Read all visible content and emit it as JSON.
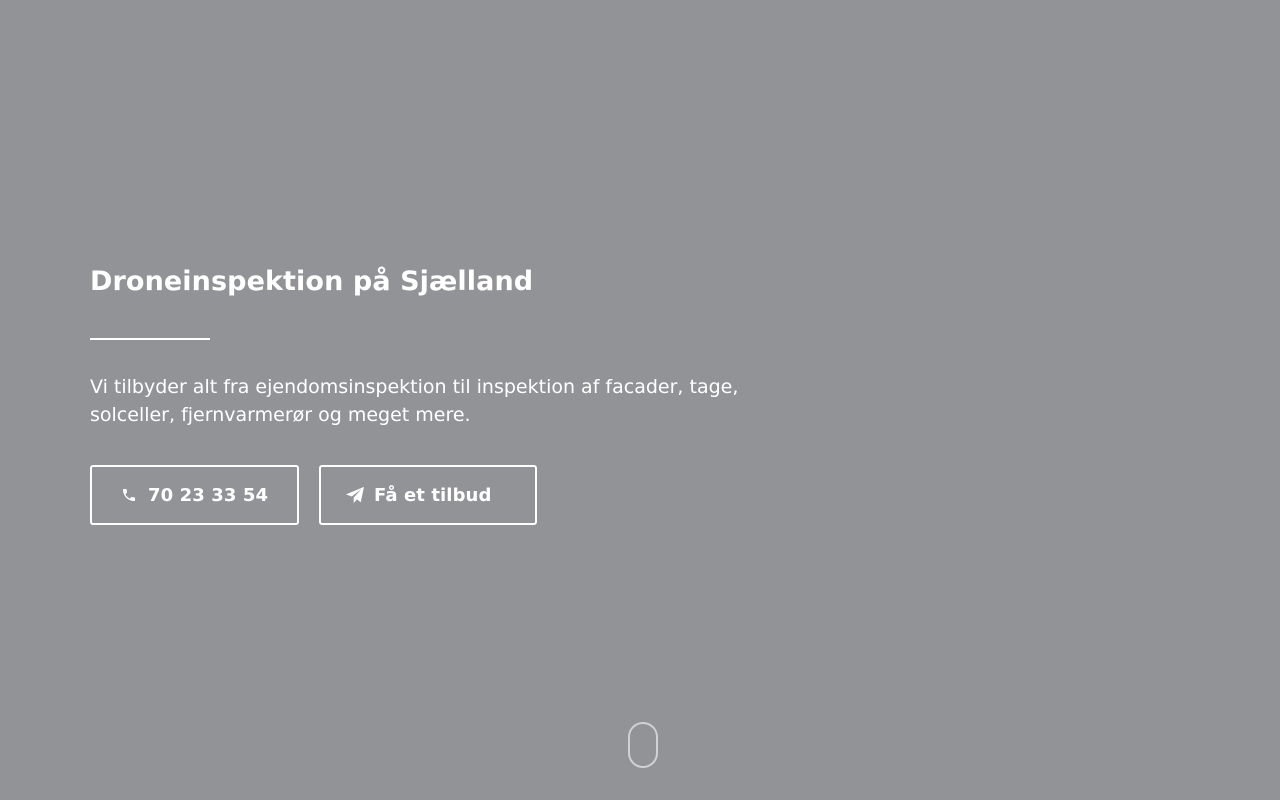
{
  "hero": {
    "title": "Droneinspektion på Sjælland",
    "text": "Vi tilbyder alt fra ejendomsinspektion til inspektion af facader, tage, solceller, fjernvarmerør og meget mere."
  },
  "buttons": {
    "phone": {
      "label": "70 23 33 54",
      "icon": "phone-icon"
    },
    "quote": {
      "label": "Få et tilbud",
      "icon": "paper-plane-icon"
    }
  },
  "scroll_indicator": {
    "icon": "mouse-scroll-icon"
  },
  "colors": {
    "background": "#929397",
    "text": "#ffffff",
    "scroll_outline": "#d0d1d3"
  }
}
